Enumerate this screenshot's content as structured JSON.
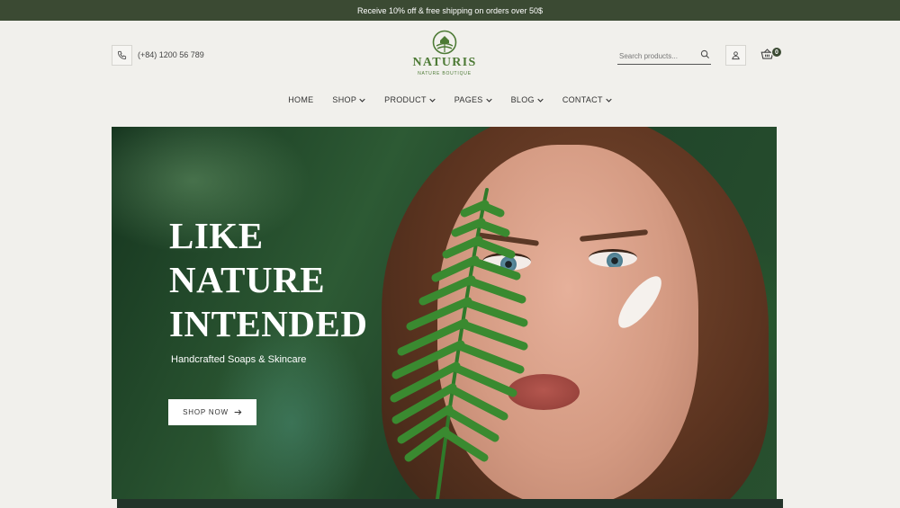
{
  "topbar": {
    "promo_text": "Receive 10% off & free shipping on orders over 50$"
  },
  "header": {
    "phone": "(+84) 1200 56 789",
    "logo": {
      "name": "NATURIS",
      "tagline": "NATURE BOUTIQUE"
    },
    "search": {
      "placeholder": "Search products..."
    },
    "cart_count": "0"
  },
  "nav": [
    {
      "label": "HOME",
      "has_dropdown": false
    },
    {
      "label": "SHOP",
      "has_dropdown": true
    },
    {
      "label": "PRODUCT",
      "has_dropdown": true
    },
    {
      "label": "PAGES",
      "has_dropdown": true
    },
    {
      "label": "BLOG",
      "has_dropdown": true
    },
    {
      "label": "CONTACT",
      "has_dropdown": true
    }
  ],
  "hero": {
    "title_lines": [
      "LIKE",
      "NATURE",
      "INTENDED"
    ],
    "subtitle": "Handcrafted Soaps & Skincare",
    "cta": "SHOP NOW"
  },
  "colors": {
    "topbar": "#3b4a33",
    "brand_green": "#4d7a35",
    "background": "#f1f0ec"
  },
  "icons": [
    "phone-icon",
    "search-icon",
    "user-icon",
    "cart-icon",
    "chevron-down-icon",
    "arrow-right-icon"
  ]
}
